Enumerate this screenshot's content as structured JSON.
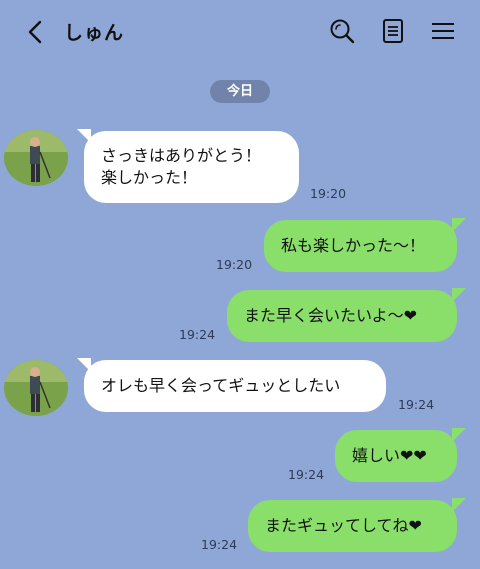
{
  "header": {
    "title": "しゅん"
  },
  "date_separator": "今日",
  "messages": [
    {
      "sender": "contact",
      "lines": [
        "さっきはありがとう！",
        "楽しかった！"
      ],
      "time": "19:20"
    },
    {
      "sender": "me",
      "text": "私も楽しかった〜！",
      "time": "19:20"
    },
    {
      "sender": "me",
      "text": "また早く会いたいよ〜❤",
      "time": "19:24"
    },
    {
      "sender": "contact",
      "text": "オレも早く会ってギュッとしたい",
      "time": "19:24"
    },
    {
      "sender": "me",
      "text": "嬉しい❤❤",
      "time": "19:24"
    },
    {
      "sender": "me",
      "text": "またギュッてしてね❤",
      "time": "19:24"
    }
  ],
  "colors": {
    "background": "#8fa7d6",
    "incoming_bubble": "#ffffff",
    "outgoing_bubble": "#8adf6b",
    "date_pill": "#7283ab"
  },
  "icons": {
    "back": "chevron-left-icon",
    "search": "search-icon",
    "notes": "notes-icon",
    "menu": "hamburger-menu-icon"
  }
}
